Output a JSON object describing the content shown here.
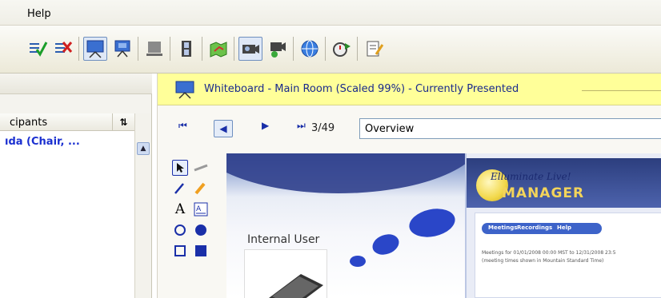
{
  "menubar": {
    "help_label": "Help"
  },
  "toolbar": {
    "buttons": [
      {
        "name": "raise-hand-approve-icon"
      },
      {
        "name": "raise-hand-deny-icon"
      },
      {
        "name": "whiteboard-present-icon",
        "active": true
      },
      {
        "name": "whiteboard-present-alt-icon"
      },
      {
        "name": "app-share-icon"
      },
      {
        "name": "film-icon"
      },
      {
        "name": "map-icon"
      },
      {
        "name": "video-camera-icon",
        "active": true
      },
      {
        "name": "video-camera-alt-icon"
      },
      {
        "name": "web-tour-icon"
      },
      {
        "name": "timer-icon"
      },
      {
        "name": "notes-icon"
      }
    ]
  },
  "participants": {
    "header_label": "cipants",
    "sort_symbol": "⇅",
    "first_row": "ıda (Chair, ..."
  },
  "whiteboard": {
    "title": "Whiteboard - Main Room (Scaled 99%) - Currently Presented",
    "page_count": "3/49",
    "page_title": "Overview"
  },
  "canvas": {
    "internal_user_label": "Internal User",
    "emanager": {
      "brand": "Elluminate Live!",
      "product": "MANAGER",
      "tabs": [
        "Meetings",
        "Recordings",
        "Help"
      ],
      "line1": "Meetings for 01/01/2008 00:00 MST to 12/31/2008 23:5",
      "line2": "(meeting times shown in Mountain Standard Time)"
    }
  },
  "colors": {
    "header_yellow": "#ffff99",
    "accent_blue": "#1a2fd0",
    "bubble_blue": "#2a46c8"
  }
}
